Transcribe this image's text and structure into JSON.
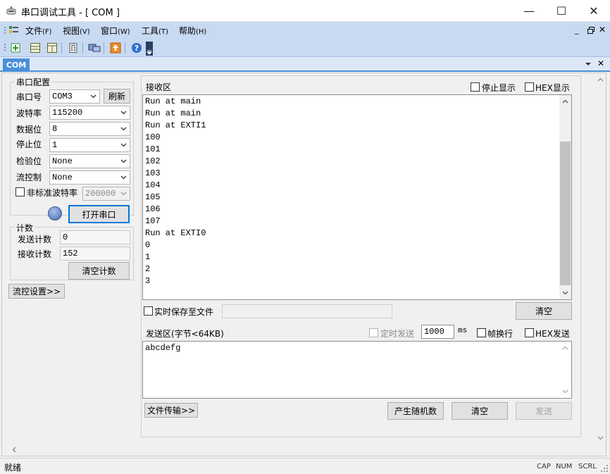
{
  "window": {
    "title": "串口调试工具 - [ COM ]",
    "minimize_glyph": "—",
    "maximize_glyph": "☐",
    "close_glyph": "✕"
  },
  "menu": {
    "items": [
      {
        "label": "文件",
        "key": "(F)"
      },
      {
        "label": "视图",
        "key": "(V)"
      },
      {
        "label": "窗口",
        "key": "(W)"
      },
      {
        "label": "工具",
        "key": "(T)"
      },
      {
        "label": "帮助",
        "key": "(H)"
      }
    ]
  },
  "toolbar": {
    "icons": [
      "new-document-icon",
      "split-horizontal-icon",
      "split-vertical-icon",
      "calculator-icon",
      "monitor-icon",
      "upload-icon",
      "help-icon"
    ]
  },
  "tabs": {
    "active": "COM"
  },
  "serial_config": {
    "group_title": "串口配置",
    "port_label": "串口号",
    "port_value": "COM3",
    "refresh_label": "刷新",
    "baud_label": "波特率",
    "baud_value": "115200",
    "databits_label": "数据位",
    "databits_value": "8",
    "stopbits_label": "停止位",
    "stopbits_value": "1",
    "parity_label": "检验位",
    "parity_value": "None",
    "flow_label": "流控制",
    "flow_value": "None",
    "nonstd_label": "非标准波特率",
    "nonstd_value": "200000",
    "open_port_label": "打开串口"
  },
  "counters": {
    "group_title": "计数",
    "sent_label": "发送计数",
    "sent_value": "0",
    "recv_label": "接收计数",
    "recv_value": "152",
    "clear_label": "清空计数"
  },
  "flow_settings_label": "流控设置>>",
  "receive": {
    "title": "接收区",
    "stop_display_label": "停止显示",
    "hex_display_label": "HEX显示",
    "lines": [
      "Run at main",
      "Run at main",
      "Run at EXTI1",
      "100",
      "101",
      "102",
      "103",
      "104",
      "105",
      "106",
      "107",
      "Run at EXTI0",
      "0",
      "1",
      "2",
      "3"
    ],
    "save_to_file_label": "实时保存至文件",
    "clear_label": "清空"
  },
  "send": {
    "title": "发送区(字节<64KB)",
    "timed_send_label": "定时发送",
    "interval_value": "1000",
    "interval_unit": "ms",
    "newline_label": "帧换行",
    "hex_send_label": "HEX发送",
    "content": "abcdefg",
    "file_transfer_label": "文件传输>>",
    "random_label": "产生随机数",
    "clear_label": "清空",
    "send_label": "发送"
  },
  "status": {
    "text": "就绪",
    "indicators": [
      "CAP",
      "NUM",
      "SCRL"
    ]
  },
  "colors": {
    "menubar_bg": "#c8d9f2",
    "tab_active": "#4a90d9",
    "led": "#6b8cc7"
  }
}
